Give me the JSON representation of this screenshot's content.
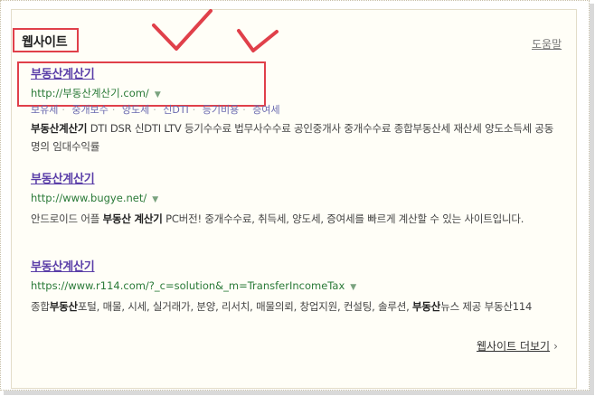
{
  "section": {
    "title": "웹사이트",
    "help": "도움말",
    "more": "웹사이트 더보기",
    "more_icon": "chevron-right-icon"
  },
  "annotations": {
    "box_color": "#e0404a",
    "check_color": "#e0404a",
    "check_count": 2
  },
  "results": [
    {
      "title": "부동산계산기",
      "url": "http://부동산계산기.com/",
      "sublinks": [
        "보유세",
        "중개보수",
        "양도세",
        "신DTI",
        "등기비용",
        "증여세"
      ],
      "desc_bold": "부동산계산기",
      "desc": " DTI DSR 신DTI LTV 등기수수료 법무사수수료 공인중개사 중개수수료 종합부동산세 재산세 양도소득세 공동명의 임대수익률"
    },
    {
      "title": "부동산계산기",
      "url": "http://www.bugye.net/",
      "desc_pre": "안드로이드 어플 ",
      "desc_bold": "부동산 계산기",
      "desc": " PC버전! 중개수수료, 취득세, 양도세, 증여세를 빠르게 계산할 수 있는 사이트입니다."
    },
    {
      "title": "부동산계산기",
      "url": "https://www.r114.com/?_c=solution&_m=TransferIncomeTax",
      "desc_pre": "종합",
      "desc_bold": "부동산",
      "desc": "포털, 매물, 시세, 실거래가, 분양, 리서치, 매물의뢰, 창업지원, 컨설팅, 솔루션, ",
      "desc_bold2": "부동산",
      "desc_post": "뉴스 제공 부동산114"
    }
  ],
  "colors": {
    "link": "#5a3ea8",
    "url": "#2a7a38",
    "panel": "#fffef7"
  }
}
